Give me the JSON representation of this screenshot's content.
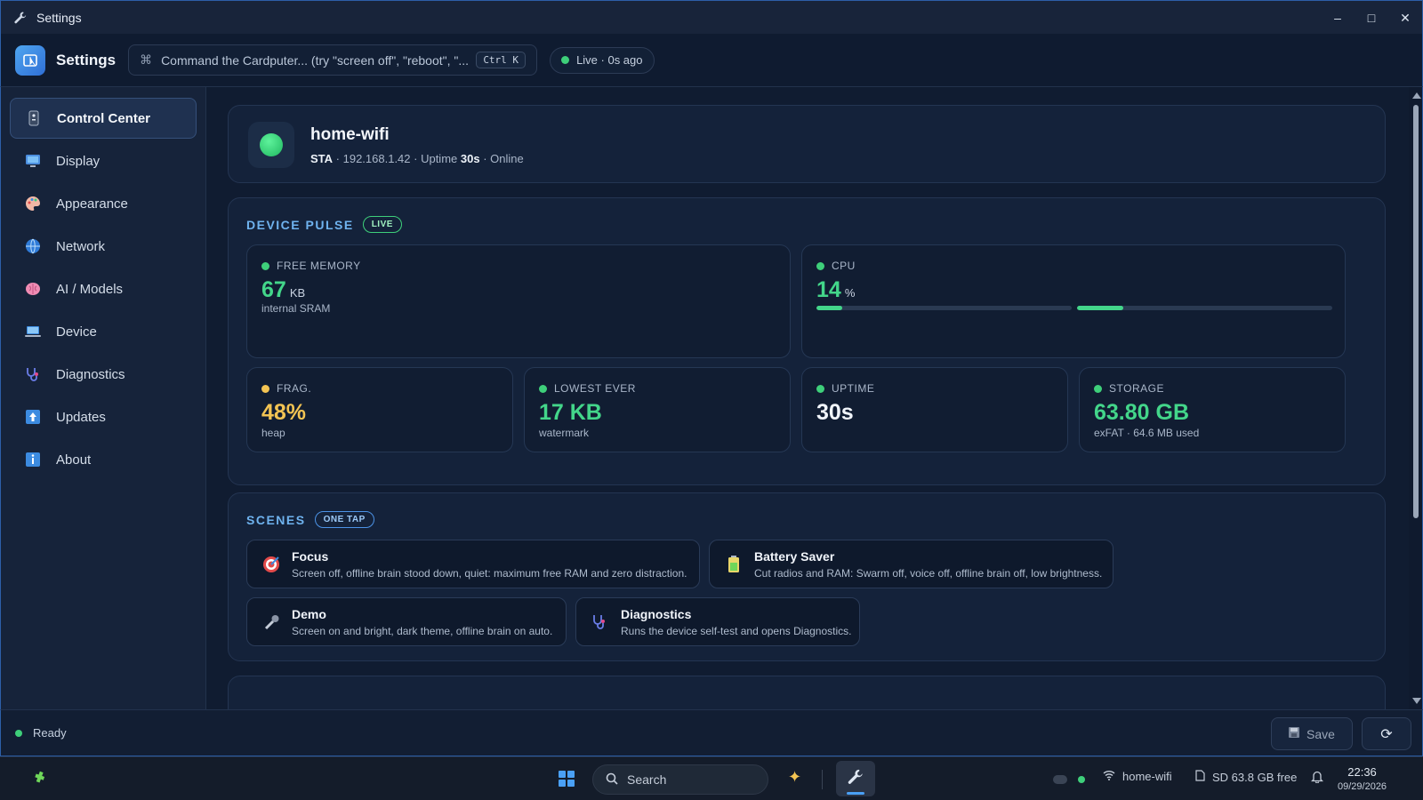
{
  "window": {
    "title": "Settings",
    "controls": [
      "–",
      "□",
      "✕"
    ]
  },
  "header": {
    "app_title": "Settings",
    "command_placeholder": "Command the Cardputer... (try \"screen off\", \"reboot\", \"...",
    "shortcut": "Ctrl K",
    "live_status": "Live · 0s ago"
  },
  "sidebar": {
    "items": [
      {
        "label": "Control Center",
        "icon": "remote-icon",
        "active": true
      },
      {
        "label": "Display",
        "icon": "display-icon"
      },
      {
        "label": "Appearance",
        "icon": "palette-icon"
      },
      {
        "label": "Network",
        "icon": "globe-icon"
      },
      {
        "label": "AI / Models",
        "icon": "brain-icon"
      },
      {
        "label": "Device",
        "icon": "laptop-icon"
      },
      {
        "label": "Diagnostics",
        "icon": "stethoscope-icon"
      },
      {
        "label": "Updates",
        "icon": "up-arrow-icon"
      },
      {
        "label": "About",
        "icon": "info-icon"
      }
    ]
  },
  "wifi": {
    "name": "home-wifi",
    "mode": "STA",
    "ip": "192.168.1.42",
    "uptime_label": "Uptime",
    "uptime": "30s",
    "state": "Online"
  },
  "pulse": {
    "title": "DEVICE PULSE",
    "badge": "LIVE",
    "free_memory": {
      "label": "FREE MEMORY",
      "value": "67",
      "unit": "KB",
      "sub": "internal SRAM"
    },
    "cpu": {
      "label": "CPU",
      "value": "14",
      "unit": "%",
      "core0_fraction": 0.1,
      "core1_fraction": 0.18
    },
    "frag": {
      "label": "FRAG.",
      "value": "48%",
      "sub": "heap"
    },
    "lowest": {
      "label": "LOWEST EVER",
      "value": "17 KB",
      "sub": "watermark"
    },
    "uptime": {
      "label": "UPTIME",
      "value": "30s"
    },
    "storage": {
      "label": "STORAGE",
      "value": "63.80 GB",
      "sub": "exFAT · 64.6 MB used"
    }
  },
  "scenes": {
    "title": "SCENES",
    "badge": "ONE TAP",
    "items": [
      {
        "title": "Focus",
        "desc": "Screen off, offline brain stood down, quiet: maximum free RAM and zero distraction.",
        "icon": "target-icon"
      },
      {
        "title": "Battery Saver",
        "desc": "Cut radios and RAM: Swarm off, voice off, offline brain off, low brightness.",
        "icon": "battery-icon"
      },
      {
        "title": "Demo",
        "desc": "Screen on and bright, dark theme, offline brain on auto.",
        "icon": "microphone-icon"
      },
      {
        "title": "Diagnostics",
        "desc": "Runs the device self-test and opens Diagnostics.",
        "icon": "stethoscope-icon"
      }
    ]
  },
  "statusbar": {
    "status": "Ready",
    "save_label": "Save"
  },
  "taskbar": {
    "search_label": "Search",
    "wifi_label": "home-wifi",
    "sd_label": "SD 63.8 GB free",
    "time": "22:36",
    "date": "09/29/2026"
  },
  "colors": {
    "accent": "#4aa0f5",
    "green": "#43d68a",
    "yellow": "#f3c453",
    "bg": "#101c31"
  }
}
